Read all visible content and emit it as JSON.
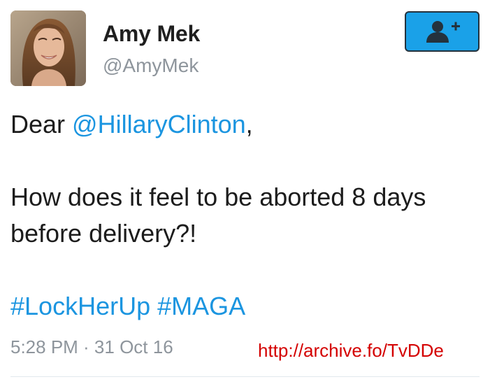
{
  "author": {
    "display_name": "Amy Mek",
    "handle": "@AmyMek",
    "avatar_icon": "profile-photo"
  },
  "follow_button": {
    "icon": "add-user-icon",
    "color": "#1aa1e8"
  },
  "tweet": {
    "line1_prefix": "Dear ",
    "mention": "@HillaryClinton",
    "line1_suffix": ",",
    "line2": "How does it feel to be aborted 8 days",
    "line3": "before delivery?!",
    "hashtag1": "#LockHerUp",
    "hashtag2": "#MAGA",
    "link_color": "#1b95e0"
  },
  "footer": {
    "timestamp": "5:28 PM · 31 Oct 16",
    "archive_link": "http://archive.fo/TvDDe",
    "archive_link_color": "#d40000"
  }
}
